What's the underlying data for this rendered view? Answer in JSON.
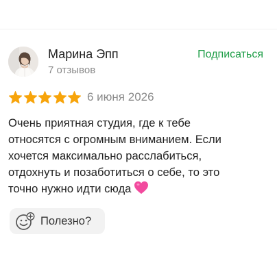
{
  "review": {
    "author_name": "Марина Эпп",
    "review_count": "7 отзывов",
    "subscribe_label": "Подписаться",
    "rating": 5,
    "rating_max": 5,
    "date": "6 июня 2026",
    "text_lines": [
      "Очень приятная студия, где к тебе",
      "относятся с огромным вниманием. Если",
      "хочется максимально расслабиться,",
      "отдохнуть и позаботиться о себе, то это",
      "точно нужно идти сюда"
    ],
    "text_emoji": "pink-heart-icon",
    "helpful_label": "Полезно?",
    "helpful_icon": "smile-add-icon"
  },
  "colors": {
    "star": "#f7a40b",
    "subscribe": "#1f9e48",
    "muted_text": "#8a8a8a",
    "helpful_bg": "#f2f2f2",
    "heart": "#f24a9e"
  }
}
